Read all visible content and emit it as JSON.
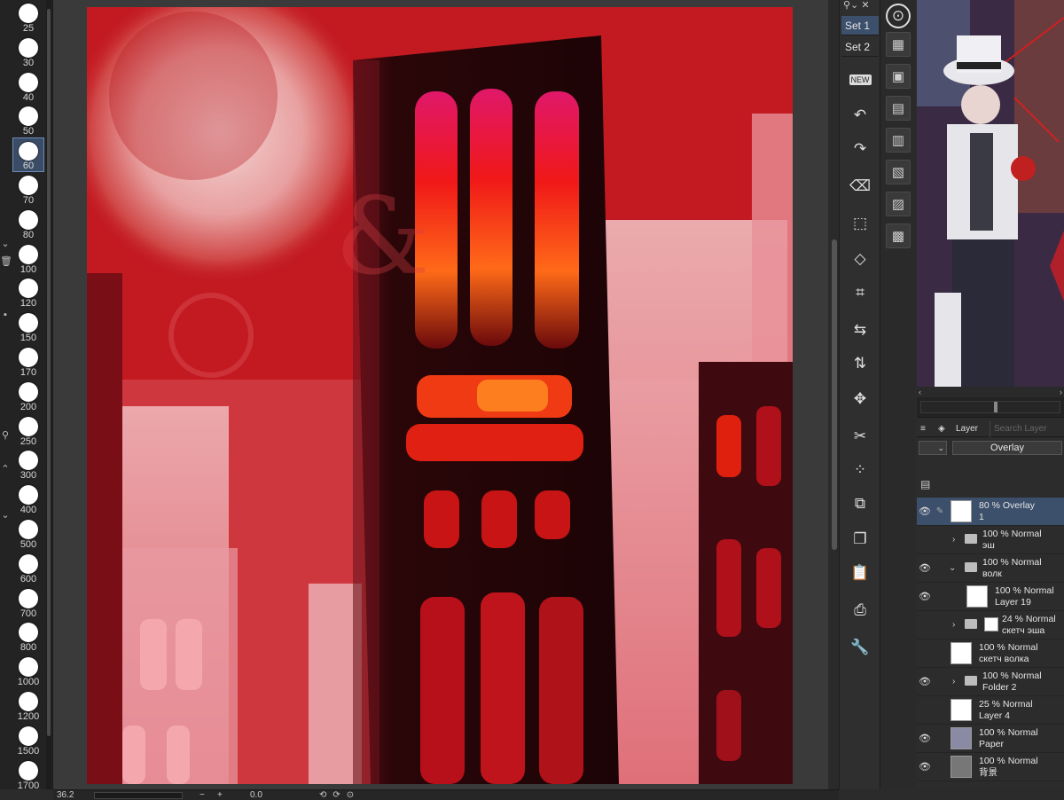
{
  "brush_sizes": [
    {
      "label": "25"
    },
    {
      "label": "30"
    },
    {
      "label": "40"
    },
    {
      "label": "50"
    },
    {
      "label": "60",
      "selected": true
    },
    {
      "label": "70"
    },
    {
      "label": "80"
    },
    {
      "label": "100"
    },
    {
      "label": "120"
    },
    {
      "label": "150"
    },
    {
      "label": "170"
    },
    {
      "label": "200"
    },
    {
      "label": "250"
    },
    {
      "label": "300"
    },
    {
      "label": "400"
    },
    {
      "label": "500"
    },
    {
      "label": "600"
    },
    {
      "label": "700"
    },
    {
      "label": "800"
    },
    {
      "label": "1000"
    },
    {
      "label": "1200"
    },
    {
      "label": "1500"
    },
    {
      "label": "1700"
    }
  ],
  "status_bar": {
    "zoom": "36.2",
    "zoom_minus": "−",
    "zoom_plus": "+",
    "rotation": "0.0"
  },
  "command_bar": {
    "set_tabs": [
      "Set 1",
      "Set 2"
    ],
    "icons": [
      "new-icon",
      "undo-icon",
      "redo-icon",
      "clear-icon",
      "crop-icon",
      "transform-icon",
      "mesh-transform-icon",
      "flip-horizontal-icon",
      "flip-vertical-icon",
      "move-icon",
      "cut-icon",
      "selection-icon",
      "copy-icon",
      "paste-icon",
      "paste-new-icon",
      "screenshot-icon",
      "settings-wrench-icon"
    ]
  },
  "navigator": {
    "preview_alt": ""
  },
  "layer_panel": {
    "tab_label": "Layer",
    "search_placeholder": "Search Layer",
    "blend_mode": "Overlay",
    "layers": [
      {
        "mode": "80 % Overlay",
        "name": "1",
        "visible": true,
        "type": "raster",
        "selected": true,
        "edit": true
      },
      {
        "mode": "100 % Normal",
        "name": "эш",
        "visible": false,
        "type": "folder",
        "fold": "›"
      },
      {
        "mode": "100 % Normal",
        "name": "волк",
        "visible": true,
        "type": "folder",
        "fold": "⌄"
      },
      {
        "mode": "100 % Normal",
        "name": "Layer 19",
        "visible": true,
        "type": "raster",
        "indent": true
      },
      {
        "mode": "24 % Normal",
        "name": "скетч эша",
        "visible": false,
        "type": "folder-mask",
        "fold": "›"
      },
      {
        "mode": "100 % Normal",
        "name": "скетч волка",
        "visible": false,
        "type": "raster"
      },
      {
        "mode": "100 % Normal",
        "name": "Folder 2",
        "visible": true,
        "type": "folder",
        "fold": "›"
      },
      {
        "mode": "25 % Normal",
        "name": "Layer 4",
        "visible": false,
        "type": "raster"
      },
      {
        "mode": "100 % Normal",
        "name": "Paper",
        "visible": true,
        "type": "paper"
      },
      {
        "mode": "100 % Normal",
        "name": "背景",
        "visible": true,
        "type": "bg"
      }
    ]
  },
  "colors": {
    "selection_blue": "#3c4f6b",
    "canvas_red": "#c0141c"
  }
}
